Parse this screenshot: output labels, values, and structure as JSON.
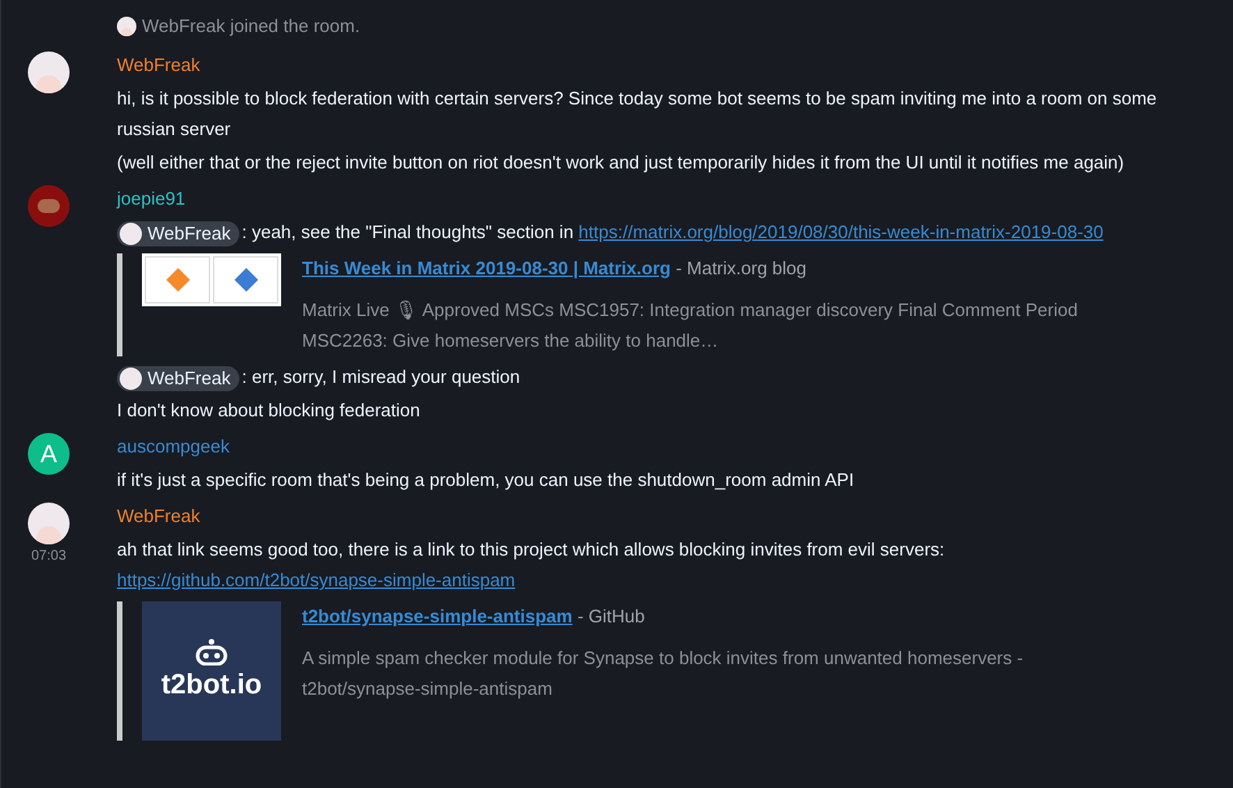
{
  "events": [
    {
      "kind": "joined",
      "text": "WebFreak joined the room."
    },
    {
      "kind": "message",
      "sender": "WebFreak",
      "avatar": {
        "kind": "picture"
      },
      "color": "#f0802c",
      "paragraphs": [
        [
          {
            "kind": "text",
            "text": "hi, is it possible to block federation with certain servers? Since today some bot seems to be spam inviting me into a room on some russian server"
          }
        ],
        [
          {
            "kind": "text",
            "text": "(well either that or the reject invite button on riot doesn't work and just temporarily hides it from the UI until it notifies me again)"
          }
        ]
      ]
    },
    {
      "kind": "message",
      "sender": "joepie91",
      "avatar": {
        "kind": "dark"
      },
      "color": "#2dc2c5",
      "paragraphs": [
        [
          {
            "kind": "mention",
            "text": "WebFreak"
          },
          {
            "kind": "text",
            "text": ": yeah, see the \"Final thoughts\" section in "
          },
          {
            "kind": "link",
            "text": "https://matrix.org/blog/2019/08/30/this-week-in-matrix-2019-08-30"
          }
        ],
        {
          "preview": {
            "kind": "screenshot",
            "title": "This Week in Matrix 2019-08-30 | Matrix.org",
            "site": " - Matrix.org blog",
            "description": "Matrix Live 🎙 Approved MSCs MSC1957: Integration manager discovery Final Comment Period MSC2263: Give homeservers the ability to handle…"
          }
        },
        [
          {
            "kind": "mention",
            "text": "WebFreak"
          },
          {
            "kind": "text",
            "text": ": err, sorry, I misread your question"
          }
        ],
        [
          {
            "kind": "text",
            "text": "I don't know about blocking federation"
          }
        ]
      ]
    },
    {
      "kind": "message",
      "sender": "auscompgeek",
      "avatar": {
        "kind": "letter",
        "letter": "A"
      },
      "color": "#368bd6",
      "paragraphs": [
        [
          {
            "kind": "text",
            "text": "if it's just a specific room that's being a problem, you can use the shutdown_room admin API"
          }
        ]
      ]
    },
    {
      "kind": "message",
      "sender": "WebFreak",
      "avatar": {
        "kind": "picture"
      },
      "color": "#f0802c",
      "time": "07:03",
      "paragraphs": [
        [
          {
            "kind": "text",
            "text": "ah that link seems good too, there is a link to this project which allows blocking invites from evil servers: "
          },
          {
            "kind": "link",
            "text": "https://github.com/t2bot/synapse-simple-antispam"
          }
        ],
        {
          "preview": {
            "kind": "logo",
            "logo_text": "t2bot.io",
            "title": "t2bot/synapse-simple-antispam",
            "site": " - GitHub",
            "description": "A simple spam checker module for Synapse to block invites from unwanted homeservers - t2bot/synapse-simple-antispam"
          }
        }
      ]
    }
  ]
}
